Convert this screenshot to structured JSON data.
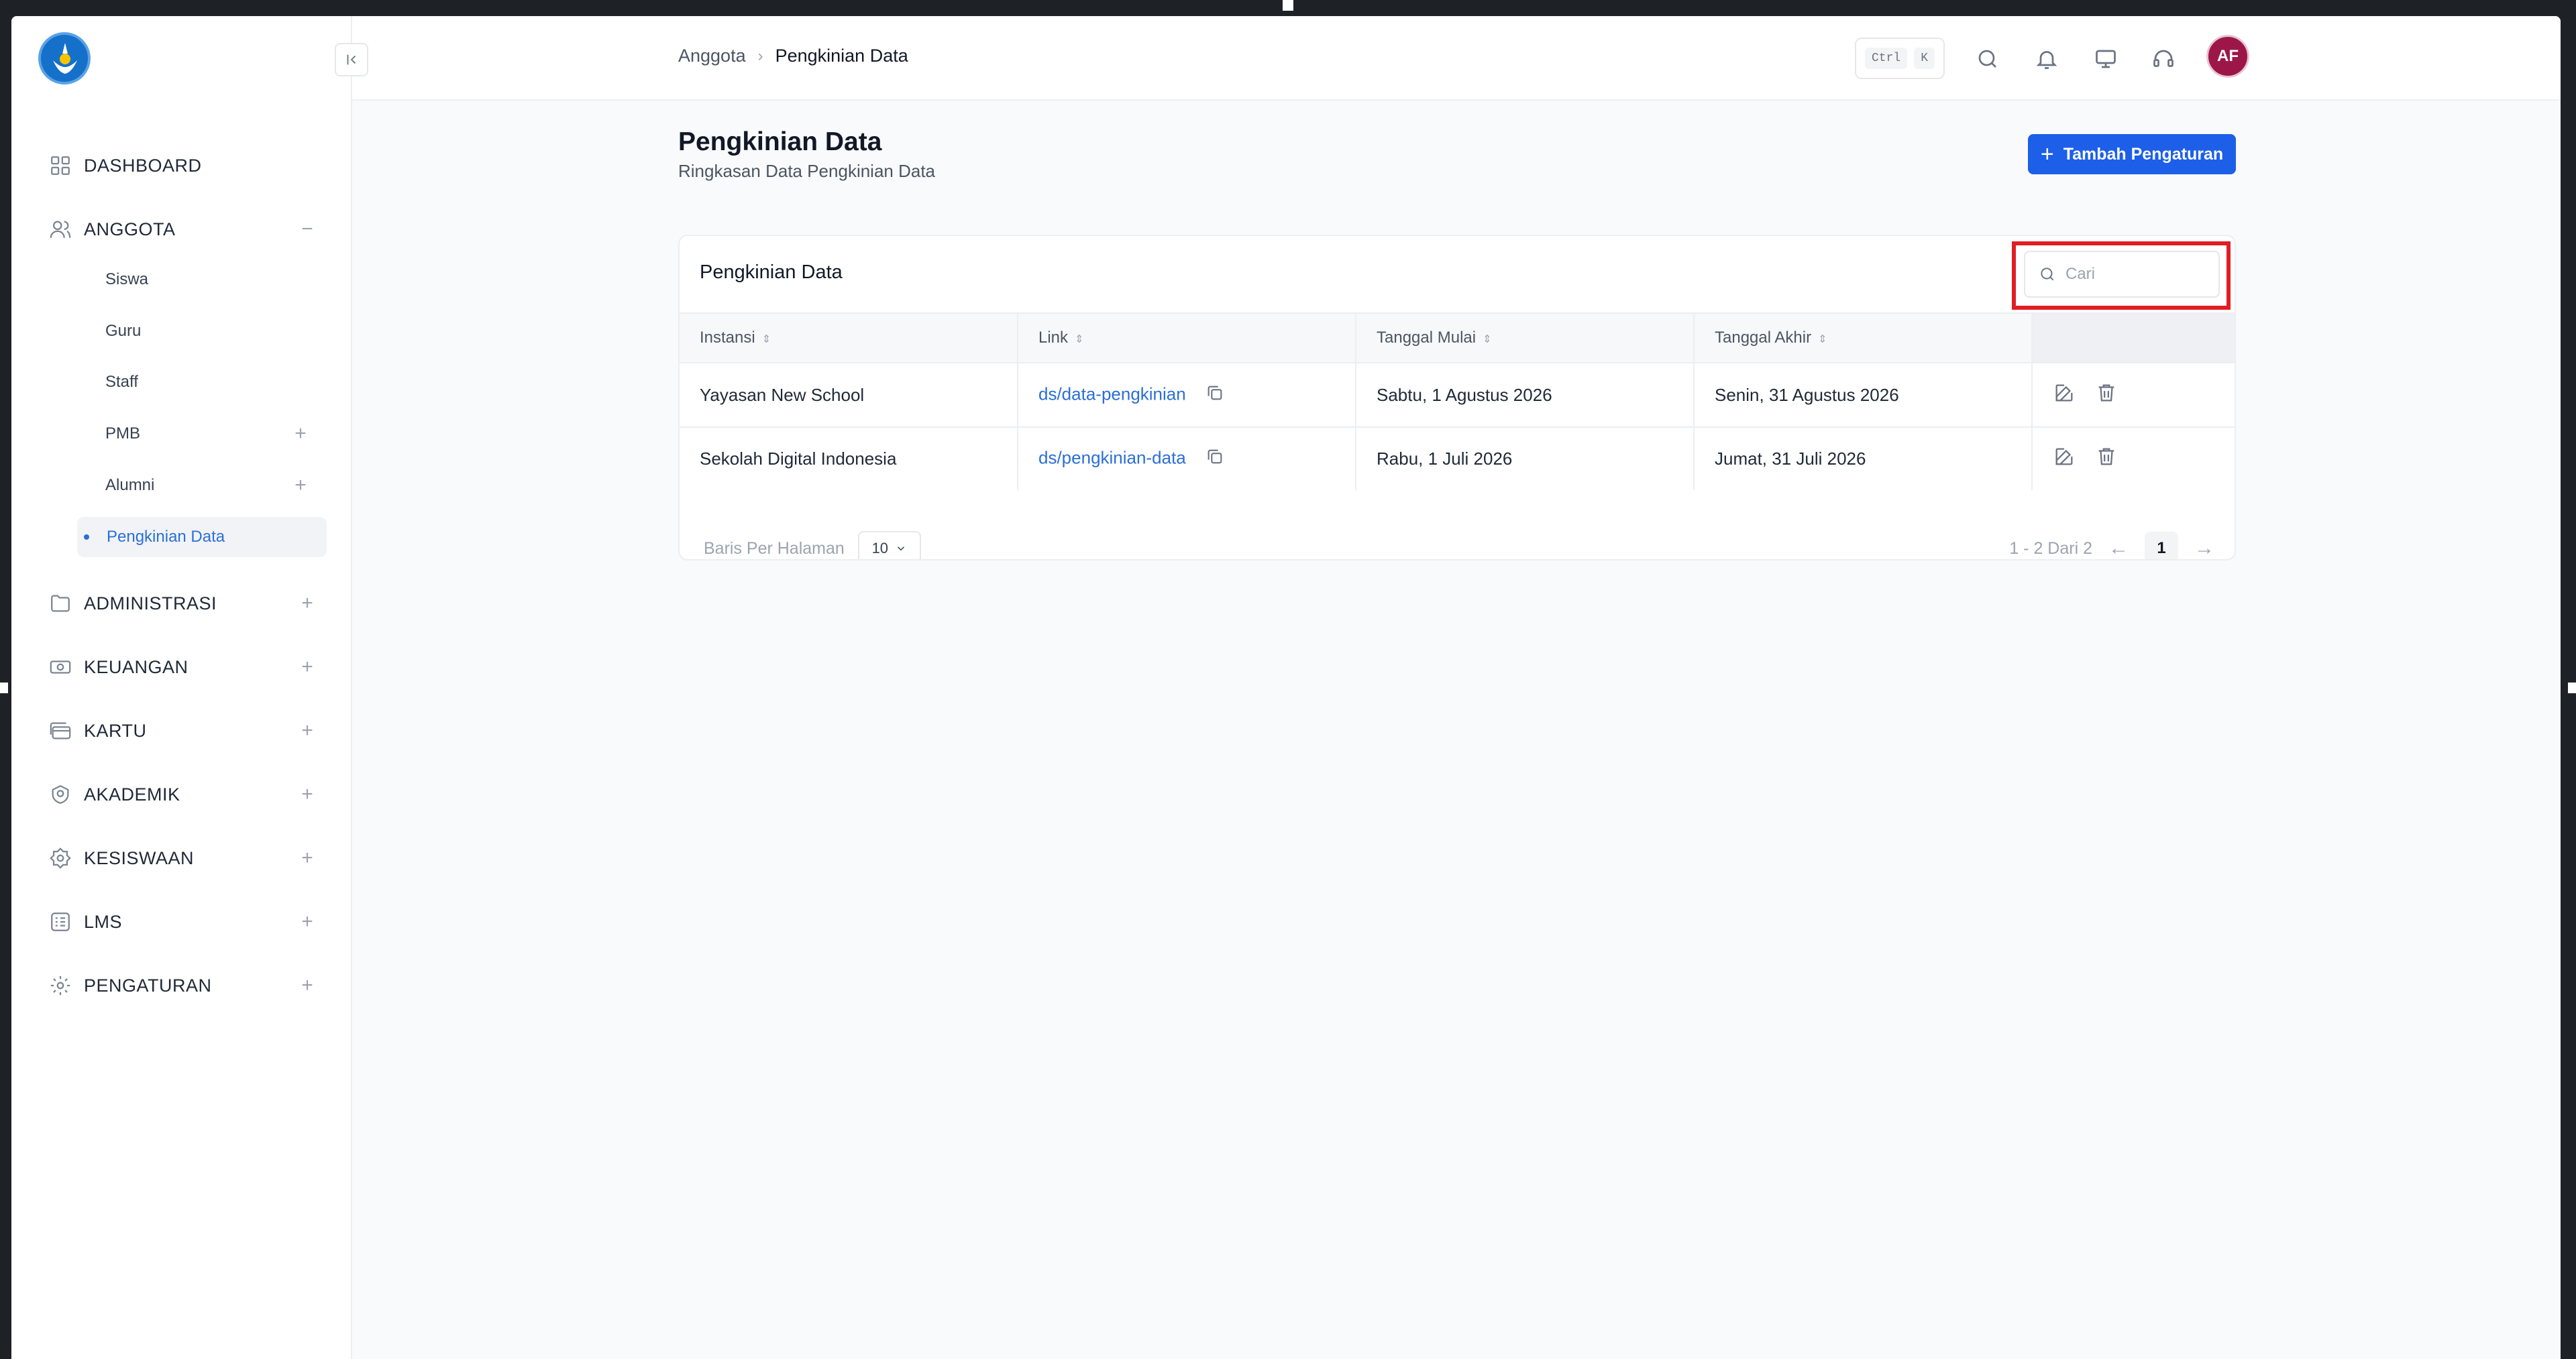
{
  "sidebar": {
    "logo_icon": "tut-wuri-handayani-logo",
    "collapse_icon": "collapse-left-icon",
    "sections": [
      {
        "label": "DASHBOARD",
        "icon": "dashboard-grid-icon",
        "toggle": ""
      },
      {
        "label": "ANGGOTA",
        "icon": "users-icon",
        "toggle": "−"
      },
      {
        "label": "ADMINISTRASI",
        "icon": "folder-icon",
        "toggle": "+"
      },
      {
        "label": "KEUANGAN",
        "icon": "money-icon",
        "toggle": "+"
      },
      {
        "label": "KARTU",
        "icon": "card-icon",
        "toggle": "+"
      },
      {
        "label": "AKADEMIK",
        "icon": "academic-icon",
        "toggle": "+"
      },
      {
        "label": "KESISWAAN",
        "icon": "badge-icon",
        "toggle": "+"
      },
      {
        "label": "LMS",
        "icon": "lms-icon",
        "toggle": "+"
      },
      {
        "label": "PENGATURAN",
        "icon": "gear-icon",
        "toggle": "+"
      }
    ],
    "anggota_items": [
      {
        "label": "Siswa",
        "toggle": ""
      },
      {
        "label": "Guru",
        "toggle": ""
      },
      {
        "label": "Staff",
        "toggle": ""
      },
      {
        "label": "PMB",
        "toggle": "+"
      },
      {
        "label": "Alumni",
        "toggle": "+"
      },
      {
        "label": "Pengkinian Data",
        "toggle": "",
        "active": true
      }
    ]
  },
  "header": {
    "breadcrumb": [
      "Anggota",
      "Pengkinian Data"
    ],
    "shortcut_keys": [
      "Ctrl",
      "K"
    ],
    "icons": [
      "search-icon",
      "bell-icon",
      "monitor-icon",
      "headset-icon"
    ],
    "avatar_initials": "AF"
  },
  "page": {
    "title": "Pengkinian Data",
    "subtitle": "Ringkasan Data Pengkinian Data",
    "add_button_label": "Tambah Pengaturan"
  },
  "table_card": {
    "title": "Pengkinian Data",
    "search_placeholder": "Cari",
    "search_value": "",
    "columns": [
      "Instansi",
      "Link",
      "Tanggal Mulai",
      "Tanggal Akhir"
    ],
    "rows": [
      {
        "instansi": "Yayasan New School",
        "link": "ds/data-pengkinian",
        "tanggal_mulai": "Sabtu, 1 Agustus 2026",
        "tanggal_akhir": "Senin, 31 Agustus 2026"
      },
      {
        "instansi": "Sekolah Digital Indonesia",
        "link": "ds/pengkinian-data",
        "tanggal_mulai": "Rabu, 1 Juli 2026",
        "tanggal_akhir": "Jumat, 31 Juli 2026"
      }
    ],
    "rows_per_page_label": "Baris Per Halaman",
    "rows_per_page_value": "10",
    "pagination_info": "1 - 2 Dari 2",
    "current_page": "1"
  },
  "colors": {
    "primary": "#1d5fe8",
    "link": "#2b6fd6",
    "highlight": "#e11d24",
    "avatar": "#9c1747"
  }
}
